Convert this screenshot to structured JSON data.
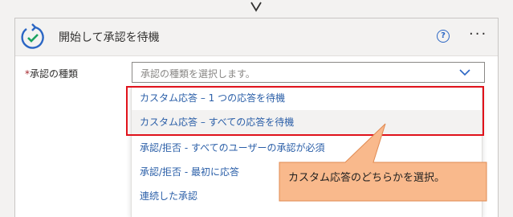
{
  "card": {
    "title": "開始して承認を待機",
    "help_glyph": "?",
    "more_glyph": "···",
    "icon": "approval-check-icon"
  },
  "field": {
    "required_mark": "*",
    "label": "承認の種類",
    "placeholder": "承認の種類を選択します。"
  },
  "dropdown": {
    "options": [
      "カスタム応答 – 1 つの応答を待機",
      "カスタム応答 – すべての応答を待機",
      "承認/拒否 - すべてのユーザーの承認が必須",
      "承認/拒否 - 最初に応答",
      "連続した承認"
    ]
  },
  "callout": {
    "text": "カスタム応答のどちらかを選択。"
  },
  "colors": {
    "accent": "#2b66c4",
    "highlight": "#e0121b",
    "callout_fill": "#f9b98c"
  }
}
